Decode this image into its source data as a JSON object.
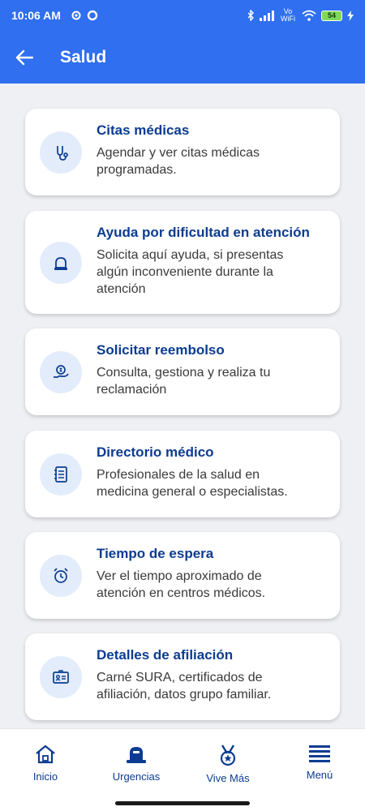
{
  "status_bar": {
    "time": "10:06 AM",
    "network_label": "Vo WiFi",
    "battery_level": "54",
    "icons": [
      "gear-icon",
      "circle-icon",
      "bluetooth-icon",
      "signal-icon",
      "wifi-icon",
      "battery-icon",
      "charging-icon"
    ]
  },
  "header": {
    "title": "Salud",
    "back_icon": "arrow-left-icon"
  },
  "cards": [
    {
      "title": "Citas médicas",
      "desc_lines": [
        "Agendar y ver citas médicas",
        "programadas."
      ],
      "icon": "stethoscope-icon"
    },
    {
      "title": "Ayuda por dificultad en atención",
      "desc_lines": [
        "Solicita aquí ayuda, si presentas",
        "algún inconveniente durante la",
        "atención"
      ],
      "icon": "siren-icon"
    },
    {
      "title": "Solicitar reembolso",
      "desc_lines": [
        "Consulta, gestiona y realiza tu",
        "reclamación"
      ],
      "icon": "money-hand-icon"
    },
    {
      "title": "Directorio médico",
      "desc_lines": [
        "Profesionales de la salud en",
        "medicina general o especialistas."
      ],
      "icon": "directory-book-icon"
    },
    {
      "title": "Tiempo de espera",
      "desc_lines": [
        "Ver el tiempo aproximado de",
        "atención en centros médicos."
      ],
      "icon": "alarm-clock-icon"
    },
    {
      "title": "Detalles de afiliación",
      "desc_lines": [
        "Carné SURA, certificados de",
        "afiliación, datos grupo familiar."
      ],
      "icon": "id-card-icon"
    }
  ],
  "bottom_nav": [
    {
      "label": "Inicio",
      "icon": "home-icon"
    },
    {
      "label": "Urgencias",
      "icon": "siren-icon"
    },
    {
      "label": "Vive Más",
      "icon": "medal-icon"
    },
    {
      "label": "Menú",
      "icon": "menu-icon"
    }
  ],
  "colors": {
    "primary": "#2f6ff0",
    "title_text": "#0b3c91",
    "background": "#eff0f4",
    "icon_bg": "#e3ecfb"
  }
}
